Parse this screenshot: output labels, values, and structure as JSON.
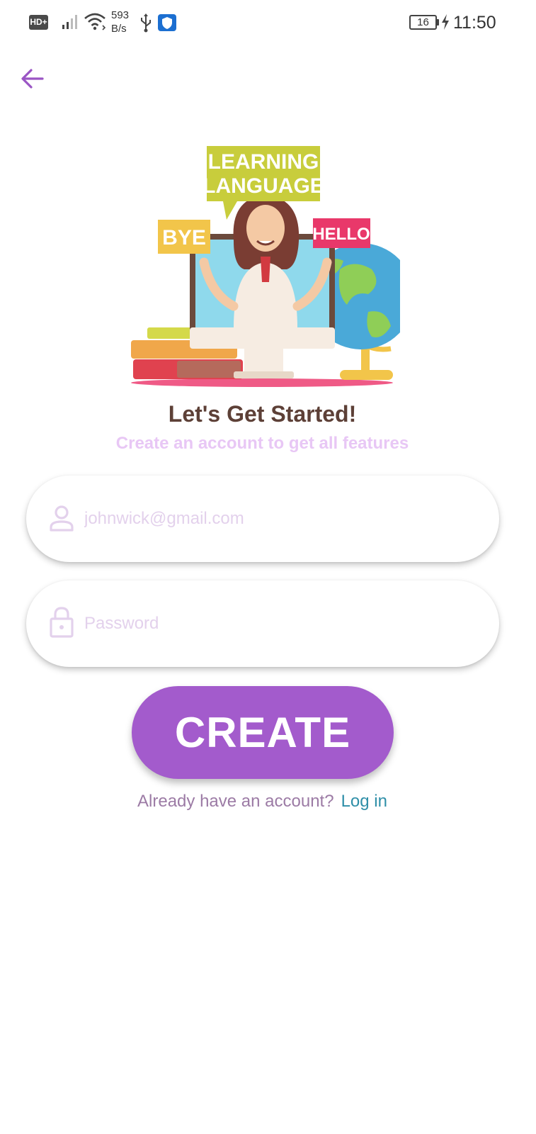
{
  "status_bar": {
    "hd_label": "HD+",
    "net_speed_value": "593",
    "net_speed_unit": "B/s",
    "battery_level": "16",
    "time": "11:50"
  },
  "illustration": {
    "sign_main_line1": "LEARNING",
    "sign_main_line2": "LANGUAGE",
    "sign_left": "BYE",
    "sign_right": "HELLO"
  },
  "header": {
    "title": "Let's Get Started!",
    "subtitle": "Create an account to get all features"
  },
  "form": {
    "email_placeholder": "johnwick@gmail.com",
    "password_placeholder": "Password",
    "create_label": "CREATE"
  },
  "footer": {
    "question": "Already have an account?",
    "login_label": "Log in"
  },
  "colors": {
    "accent": "#a35bcc",
    "title": "#5d4037",
    "subtitle": "#e8c7f5",
    "link": "#2f8fa8"
  },
  "icons": [
    "back-arrow-icon",
    "user-icon",
    "lock-icon",
    "wifi-icon",
    "signal-icon",
    "usb-icon",
    "shield-icon",
    "charging-bolt-icon"
  ]
}
